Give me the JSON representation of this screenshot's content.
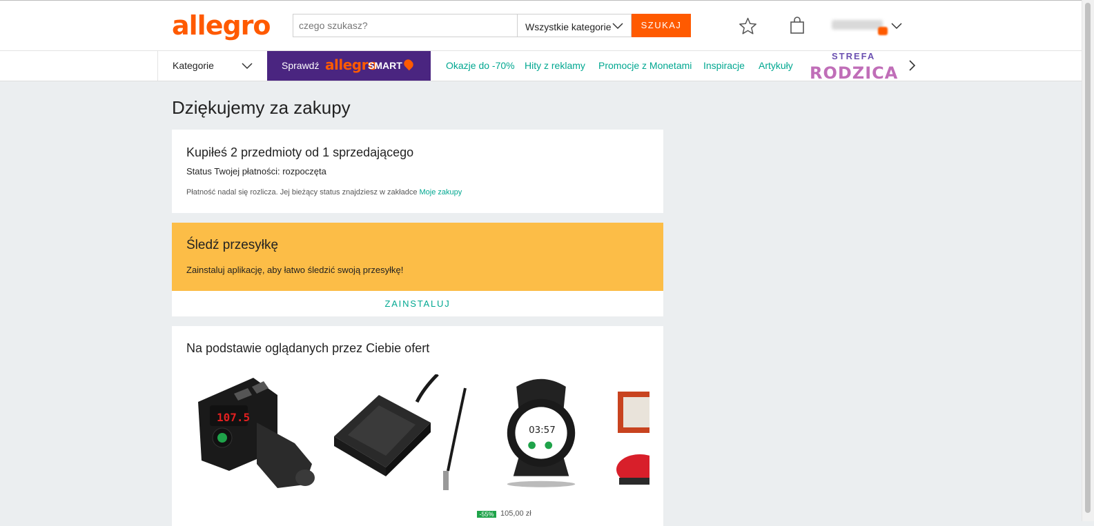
{
  "header": {
    "logo": "allegro",
    "search_placeholder": "czego szukasz?",
    "category": "Wszystkie kategorie",
    "search_button": "SZUKAJ"
  },
  "nav": {
    "categories": "Kategorie",
    "smart_prefix": "Sprawdź",
    "smart_brand": "allegro",
    "smart_label": "SMART",
    "links": [
      "Okazje do -70%",
      "Hity z reklamy",
      "Promocje z Monetami",
      "Inspiracje",
      "Artykuły"
    ],
    "strefa_top": "STREFA",
    "strefa_bottom": "RODZICA"
  },
  "page": {
    "title": "Dziękujemy za zakupy"
  },
  "purchase": {
    "heading": "Kupiłeś 2 przedmioty od 1 sprzedającego",
    "status": "Status Twojej płatności: rozpoczęta",
    "note": "Płatność nadal się rozlicza. Jej bieżący status znajdziesz w zakładce",
    "link": "Moje zakupy"
  },
  "tracking": {
    "heading": "Śledź przesyłkę",
    "text": "Zainstaluj aplikację, aby łatwo śledzić swoją przesyłkę!",
    "button": "ZAINSTALUJ"
  },
  "recommendations": {
    "heading": "Na podstawie oglądanych przez Ciebie ofert",
    "discount": "-55%",
    "price": "105,00 zł"
  },
  "colors": {
    "brand": "#ff5a00",
    "accent": "#00a790",
    "smart_bg": "#4a2580",
    "tracking_bg": "#fcbd47"
  }
}
